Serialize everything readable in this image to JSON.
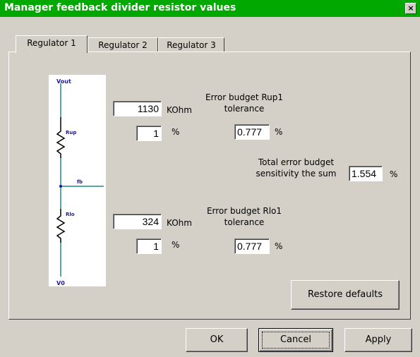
{
  "window": {
    "title": "Manager feedback divider resistor values",
    "close_glyph": "×"
  },
  "tabs": [
    {
      "label": "Regulator 1",
      "selected": true
    },
    {
      "label": "Regulator 2",
      "selected": false
    },
    {
      "label": "Regulator 3",
      "selected": false
    }
  ],
  "rup": {
    "value": "1130",
    "value_unit": "KOhm",
    "tolerance": "1",
    "tolerance_unit": "%",
    "budget_label_line1": "Error budget Rup1",
    "budget_label_line2": "tolerance",
    "budget_value": "0.777",
    "budget_unit": "%"
  },
  "rlo": {
    "value": "324",
    "value_unit": "KOhm",
    "tolerance": "1",
    "tolerance_unit": "%",
    "budget_label_line1": "Error budget Rlo1",
    "budget_label_line2": "tolerance",
    "budget_value": "0.777",
    "budget_unit": "%"
  },
  "total": {
    "label_line1": "Total error budget",
    "label_line2": "sensitivity the sum",
    "value": "1.554",
    "unit": "%"
  },
  "schematic": {
    "top_label": "Vout",
    "rup_label": "Rup",
    "rlo_label": "Rlo",
    "fb_label": "fb",
    "bottom_label": "V0",
    "wire_color": "#1f8a8a",
    "text_color": "#1a1a9a"
  },
  "buttons": {
    "restore": "Restore defaults",
    "ok": "OK",
    "cancel": "Cancel",
    "apply": "Apply"
  },
  "colors": {
    "titlebar": "#00a800",
    "dialog": "#d4d0c8"
  }
}
